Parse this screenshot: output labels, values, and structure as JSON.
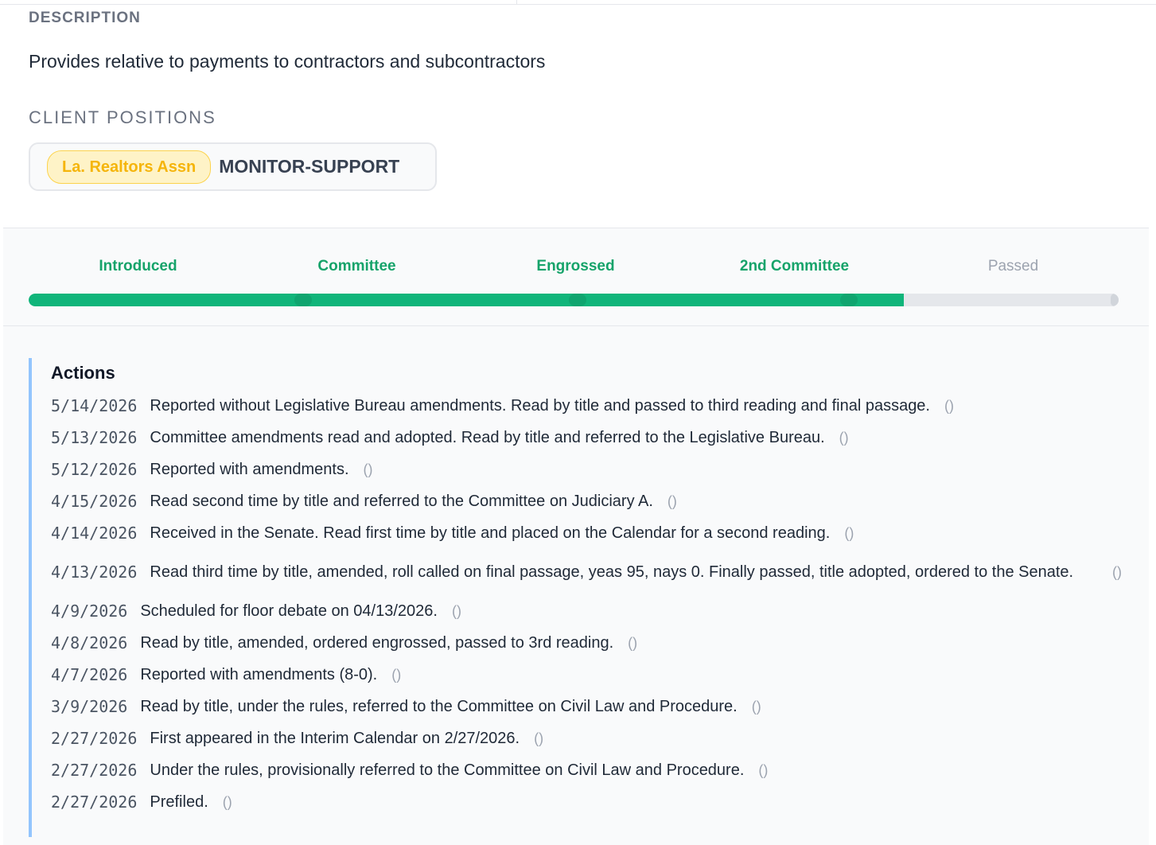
{
  "description": {
    "heading": "DESCRIPTION",
    "text": "Provides relative to payments to contractors and subcontractors"
  },
  "client_positions": {
    "heading": "CLIENT POSITIONS",
    "items": [
      {
        "client": "La. Realtors Assn",
        "position": "MONITOR-SUPPORT"
      }
    ]
  },
  "progress": {
    "stages": [
      {
        "label": "Introduced",
        "complete": true
      },
      {
        "label": "Committee",
        "complete": true
      },
      {
        "label": "Engrossed",
        "complete": true
      },
      {
        "label": "2nd Committee",
        "complete": true
      },
      {
        "label": "Passed",
        "complete": false
      }
    ],
    "fill_fraction": 0.803,
    "completed_color": "#10b57a",
    "pending_color": "#e5e7eb"
  },
  "actions": {
    "title": "Actions",
    "link_text": "()",
    "items": [
      {
        "date": "5/14/2026",
        "text": "Reported without Legislative Bureau amendments. Read by title and passed to third reading and final passage."
      },
      {
        "date": "5/13/2026",
        "text": "Committee amendments read and adopted. Read by title and referred to the Legislative Bureau."
      },
      {
        "date": "5/12/2026",
        "text": "Reported with amendments."
      },
      {
        "date": "4/15/2026",
        "text": "Read second time by title and referred to the Committee on Judiciary A."
      },
      {
        "date": "4/14/2026",
        "text": "Received in the Senate. Read first time by title and placed on the Calendar for a second reading."
      },
      {
        "date": "4/13/2026",
        "text": "Read third time by title, amended, roll called on final passage, yeas 95, nays 0. Finally passed, title adopted, ordered to the Senate."
      },
      {
        "date": "4/9/2026",
        "text": "Scheduled for floor debate on 04/13/2026."
      },
      {
        "date": "4/8/2026",
        "text": "Read by title, amended, ordered engrossed, passed to 3rd reading."
      },
      {
        "date": "4/7/2026",
        "text": "Reported with amendments (8-0)."
      },
      {
        "date": "3/9/2026",
        "text": "Read by title, under the rules, referred to the Committee on Civil Law and Procedure."
      },
      {
        "date": "2/27/2026",
        "text": "First appeared in the Interim Calendar on 2/27/2026."
      },
      {
        "date": "2/27/2026",
        "text": "Under the rules, provisionally referred to the Committee on Civil Law and Procedure."
      },
      {
        "date": "2/27/2026",
        "text": "Prefiled."
      }
    ]
  }
}
